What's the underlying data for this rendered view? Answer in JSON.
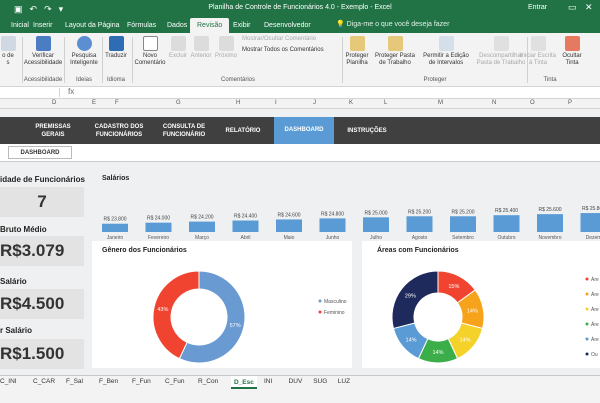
{
  "window": {
    "title": "Planilha de Controle de Funcionários 4.0 - Exemplo  -  Excel",
    "signin": "Entrar"
  },
  "ribbon_tabs": [
    "Inicial",
    "Inserir",
    "Layout da Página",
    "Fórmulas",
    "Dados",
    "Revisão",
    "Exibir",
    "Desenvolvedor"
  ],
  "tell_me": "Diga-me o que você deseja fazer",
  "ribbon": {
    "spelling": "o de\ns",
    "accessibility": "Verificar\nAcessibilidade",
    "smart_lookup": "Pesquisa\nInteligente",
    "translate": "Traduzir",
    "new_comment": "Novo\nComentário",
    "delete": "Excluir",
    "previous": "Anterior",
    "next": "Próximo",
    "show_hide_comment": "Mostrar/Ocultar Comentário",
    "show_all_comments": "Mostrar Todos os Comentários",
    "protect_sheet": "Proteger\nPlanilha",
    "protect_workbook": "Proteger Pasta\nde Trabalho",
    "allow_edit_ranges": "Permitir a Edição\nde Intervalos",
    "unshare_workbook": "Descompartilhar\nPasta de Trabalho",
    "start_inking": "Iniciar Escrita\nà Tinta",
    "hide_ink": "Ocultar\nTinta",
    "groups": {
      "accessibility": "Acessibilidade",
      "ideas": "Ideias",
      "language": "Idioma",
      "comments": "Comentários",
      "protect": "Proteger",
      "ink": "Tinta"
    }
  },
  "columns": [
    "D",
    "E",
    "F",
    "G",
    "H",
    "I",
    "J",
    "K",
    "L",
    "M",
    "N",
    "O",
    "P"
  ],
  "menu": {
    "premissas": "PREMISSAS\nGERAIS",
    "cadastro": "CADASTRO DOS\nFUNCIONÁRIOS",
    "consulta": "CONSULTA DE\nFUNCIONÁRIO",
    "relatorio": "RELATÓRIO",
    "dashboard": "DASHBOARD",
    "instrucoes": "INSTRUÇÕES"
  },
  "sub_button": "DASHBOARD",
  "kpis": {
    "count_label": "idade de Funcionários",
    "count_value": "7",
    "avg_label": "Bruto Médio",
    "avg_value": "R$3.079",
    "max_label": "Salário",
    "max_value": "R$4.500",
    "min_label": "r Salário",
    "min_value": "R$1.500"
  },
  "salary_card_title": "Salários",
  "gender_card_title": "Gênero dos Funcionários",
  "areas_card_title": "Áreas com Funcionários",
  "chart_data": [
    {
      "type": "bar",
      "title": "Salários",
      "categories": [
        "Janeiro",
        "Fevereiro",
        "Março",
        "Abril",
        "Maio",
        "Junho",
        "Julho",
        "Agosto",
        "Setembro",
        "Outubro",
        "Novembro",
        "Dezem"
      ],
      "labels": [
        "R$ 23.800",
        "R$ 24.000",
        "R$ 24.200",
        "R$ 24.400",
        "R$ 24.600",
        "R$ 24.800",
        "R$ 25.000",
        "R$ 25.200",
        "R$ 25.200",
        "R$ 25.400",
        "R$ 25.600",
        "R$ 25.800"
      ],
      "values": [
        23800,
        24000,
        24200,
        24400,
        24600,
        24800,
        25000,
        25200,
        25200,
        25400,
        25600,
        25800
      ],
      "color": "#5b9bd5"
    },
    {
      "type": "pie",
      "title": "Gênero dos Funcionários",
      "categories": [
        "Masculino",
        "Feminino"
      ],
      "values": [
        57,
        43
      ],
      "labels": [
        "57%",
        "43%"
      ],
      "colors": [
        "#6a9ad2",
        "#f04431"
      ]
    },
    {
      "type": "pie",
      "title": "Áreas com Funcionários",
      "values": [
        15,
        14,
        14,
        14,
        14,
        29
      ],
      "labels": [
        "15%",
        "14%",
        "14%",
        "14%",
        "14%",
        "29%"
      ],
      "colors": [
        "#f04431",
        "#f7a21b",
        "#f5d229",
        "#3cae49",
        "#5b9bd5",
        "#1f2a5c"
      ],
      "legend": [
        "Áre",
        "Áre",
        "Áre",
        "Áre",
        "Áre",
        "Ou"
      ]
    }
  ],
  "sheet_tabs": [
    "C_INI",
    "C_CAR",
    "F_Sal",
    "F_Ben",
    "F_Fun",
    "C_Fun",
    "R_Con",
    "D_Esc",
    "INI",
    "DUV",
    "SUG",
    "LUZ"
  ],
  "active_sheet": "D_Esc"
}
